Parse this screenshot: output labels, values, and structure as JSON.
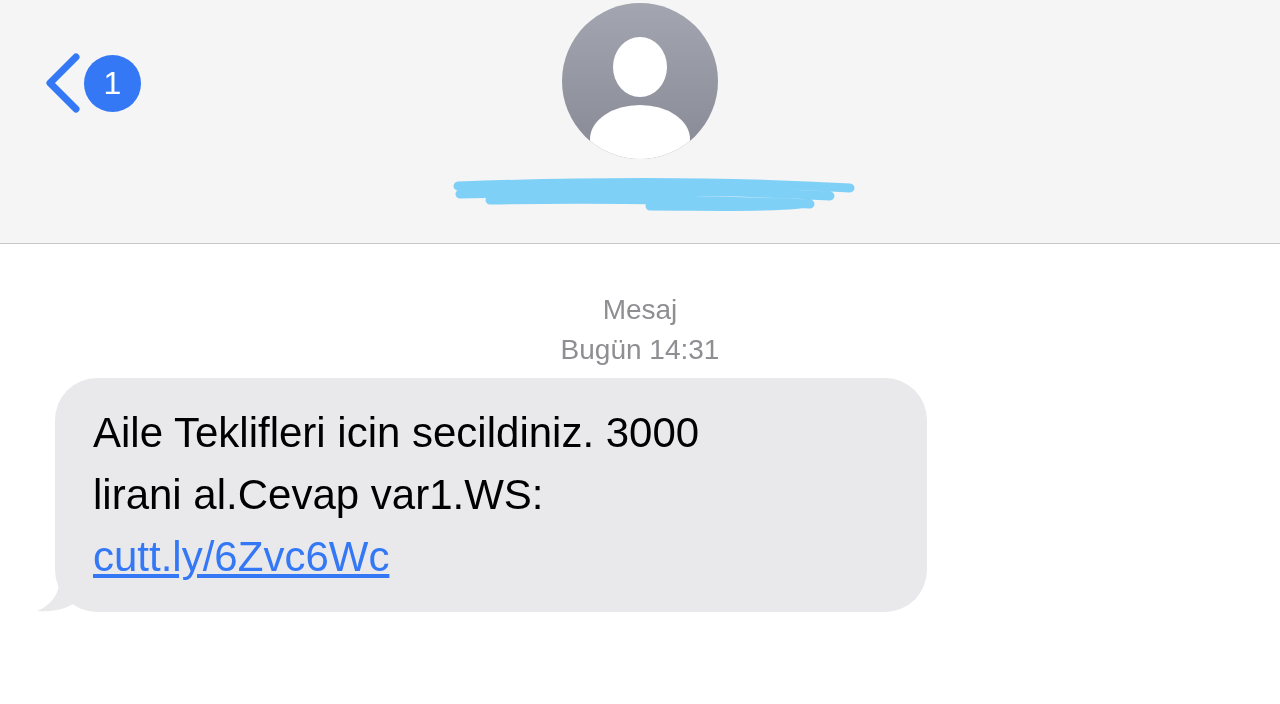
{
  "header": {
    "unread_badge": "1"
  },
  "timestamp": {
    "label": "Mesaj",
    "time": "Bugün 14:31"
  },
  "messages": [
    {
      "text": "Aile Teklifleri icin secildiniz. 3000 lirani al.Cevap var1.WS:",
      "link": "cutt.ly/6Zvc6Wc"
    }
  ]
}
